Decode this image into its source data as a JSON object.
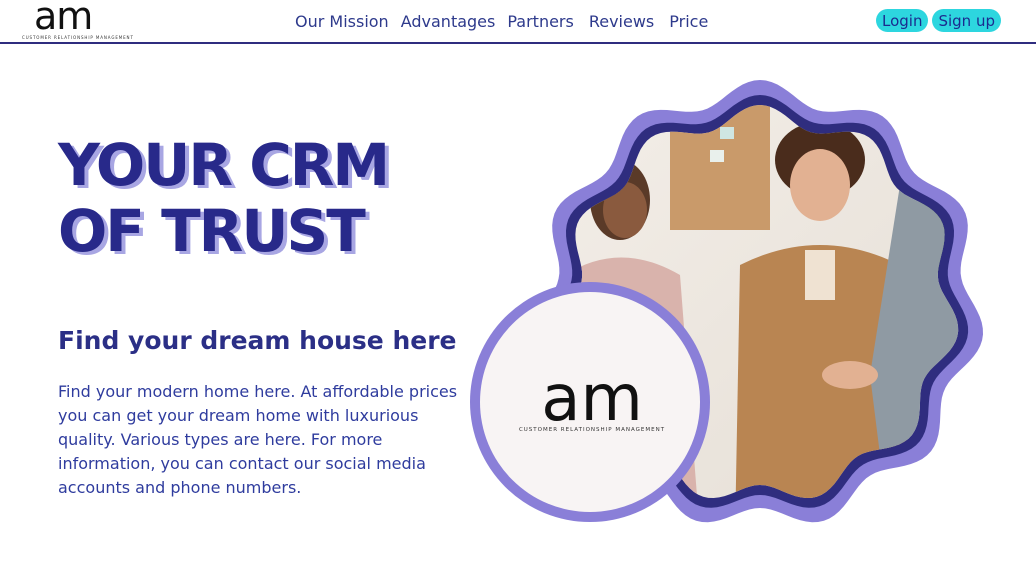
{
  "header": {
    "logo_mark": "am",
    "logo_sub": "CUSTOMER RELATIONSHIP MANAGEMENT",
    "nav": [
      "Our Mission",
      "Advantages",
      "Partners",
      "Reviews",
      "Price"
    ],
    "login_label": "Login",
    "signup_label": "Sign up"
  },
  "hero": {
    "title_line1": "YOUR CRM",
    "title_line2": "OF TRUST",
    "subtitle": "Find your dream house here",
    "description": "Find your modern home here. At affordable prices you can get your dream home with luxurious quality. Various types are here. For more information, you can contact our social media accounts and phone numbers."
  },
  "badge": {
    "logo_mark": "am",
    "logo_sub": "CUSTOMER RELATIONSHIP MANAGEMENT"
  },
  "colors": {
    "primary": "#2b2f86",
    "accent_cyan": "#2dd6df",
    "lavender": "#8a7fd8",
    "dark_navy": "#2f2d7f"
  },
  "photo": {
    "icon": "business-handshake-photo"
  }
}
